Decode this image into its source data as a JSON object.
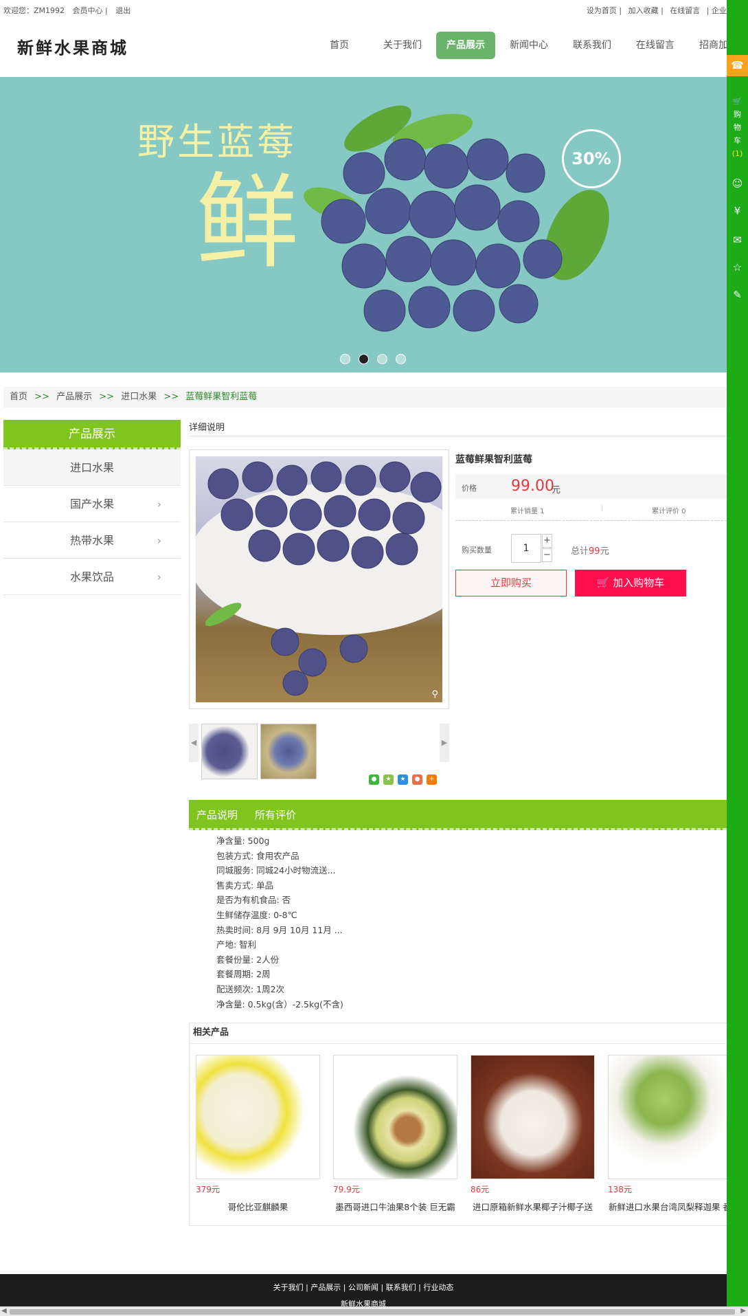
{
  "topbar": {
    "welcome": "欢迎您：ZM1992",
    "member_center": "会员中心 |",
    "logout": "退出",
    "set_home": "设为首页 |",
    "add_favorite": "加入收藏 |",
    "online_message": "在线留言",
    "enterprise": "| 企业"
  },
  "logo": "新鲜水果商城",
  "nav": [
    "首页",
    "关于我们",
    "产品展示",
    "新闻中心",
    "联系我们",
    "在线留言",
    "招商加盟"
  ],
  "banner": {
    "title": "野生蓝莓",
    "big_char": "鲜",
    "badge": "30%"
  },
  "breadcrumb": {
    "home": "首页",
    "products": "产品展示",
    "category": "进口水果",
    "current": "蓝莓鲜果智利蓝莓",
    "separator": ">>"
  },
  "sidebar": {
    "title": "产品展示",
    "items": [
      "进口水果",
      "国产水果",
      "热带水果",
      "水果饮品"
    ]
  },
  "detail": {
    "section_title": "详细说明",
    "product_name": "蓝莓鲜果智利蓝莓",
    "price_label": "价格",
    "price": "99.00",
    "price_unit": "元",
    "sales": "累计销量 1",
    "reviews": "累计评价 0",
    "qty_label": "购买数量",
    "qty": "1",
    "total_prefix": "总计",
    "total_amount": "99",
    "total_unit": "元",
    "buy_now": "立即购买",
    "add_cart": "加入购物车"
  },
  "tabs": [
    "产品说明",
    "所有评价"
  ],
  "specs": [
    "净含量: 500g",
    "包装方式: 食用农产品",
    "同城服务: 同城24小时物流送...",
    "售卖方式: 单品",
    "是否为有机食品: 否",
    "生鲜储存温度: 0-8℃",
    "热卖时间: 8月 9月 10月 11月 ...",
    "产地: 智利",
    "套餐份量: 2人份",
    "套餐周期: 2周",
    "配送频次: 1周2次",
    "净含量: 0.5kg(含）-2.5kg(不含)"
  ],
  "related": {
    "title": "相关产品",
    "items": [
      {
        "price": "379元",
        "name": "哥伦比亚麒麟果"
      },
      {
        "price": "79.9元",
        "name": "墨西哥进口牛油果8个装 巨无霸"
      },
      {
        "price": "86元",
        "name": "进口原箱新鲜水果椰子汁椰子送"
      },
      {
        "price": "138元",
        "name": "新鲜进口水果台湾凤梨释迦果 番"
      }
    ]
  },
  "footer": {
    "links": "关于我们 |  产品展示 |  公司新闻 |  联系我们 |  行业动态",
    "site_name": "新鲜水果商城"
  },
  "rail": {
    "cart_text": [
      "购",
      "物",
      "车"
    ],
    "cart_count": "(1)"
  },
  "colors": {
    "brand_green": "#7fc41f",
    "rail_green": "#1bac18",
    "nav_active": "#6ab36b",
    "price_red": "#e4393c",
    "cart_button": "#ff0f4c"
  },
  "icons": [
    "service-icon",
    "cart-icon",
    "user-icon",
    "yen-icon",
    "mail-icon",
    "star-icon",
    "edit-icon",
    "wechat-icon",
    "qzone-icon",
    "favorite-icon",
    "weibo-icon",
    "more-icon"
  ]
}
